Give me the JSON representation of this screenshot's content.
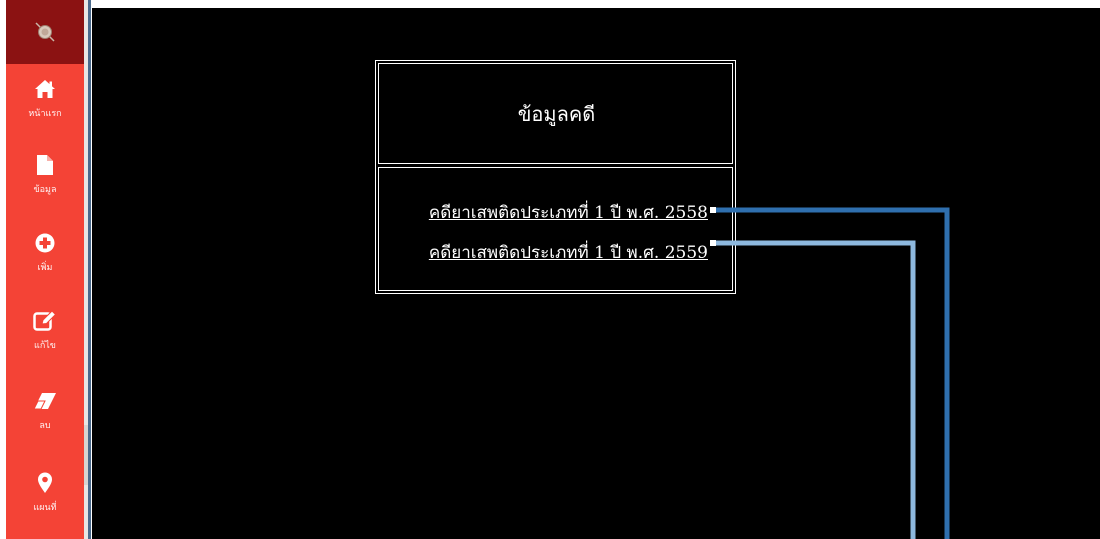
{
  "sidebar": {
    "logo": "court-emblem",
    "items": [
      {
        "label": "หน้าแรก",
        "icon": "home-icon"
      },
      {
        "label": "ข้อมูล",
        "icon": "document-icon"
      },
      {
        "label": "เพิ่ม",
        "icon": "plus-circle-icon"
      },
      {
        "label": "แก้ไข",
        "icon": "edit-icon"
      },
      {
        "label": "ลบ",
        "icon": "eraser-icon"
      },
      {
        "label": "แผนที่",
        "icon": "map-marker-icon"
      }
    ]
  },
  "main": {
    "table_title": "ข้อมูลคดี",
    "links": [
      {
        "label": "คดียาเสพติดประเภทที่ 1 ปี พ.ศ. 2558"
      },
      {
        "label": "คดียาเสพติดประเภทที่ 1 ปี พ.ศ. 2559"
      }
    ]
  },
  "colors": {
    "sidebar": "#f44336",
    "logo_bg": "#8b1212",
    "main_bg": "#000000",
    "connector_dark": "#2f6fae",
    "connector_light": "#8db8de"
  }
}
